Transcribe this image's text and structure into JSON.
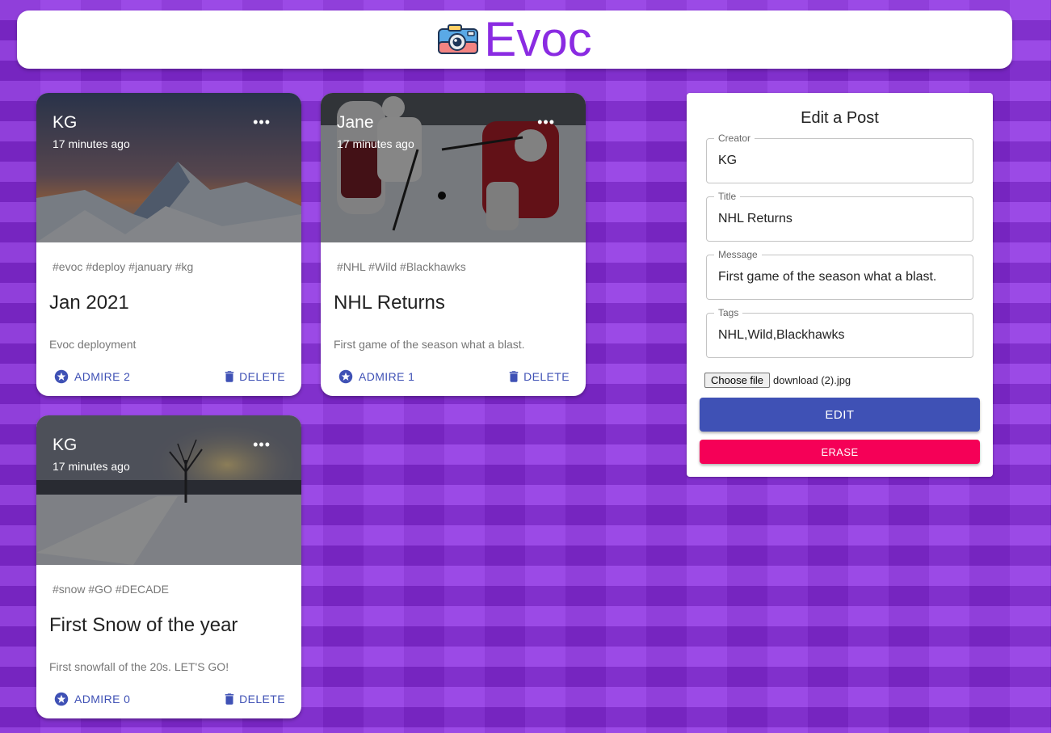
{
  "app": {
    "title": "Evoc",
    "logo_icon": "camera-icon"
  },
  "colors": {
    "accent": "#8a2be2",
    "primary": "#3f51b5",
    "secondary": "#f50057"
  },
  "posts": [
    {
      "creator": "KG",
      "time": "17 minutes ago",
      "more": "•••",
      "tags": "#evoc #deploy #january #kg",
      "title": "Jan 2021",
      "message": "Evoc deployment",
      "admire_label": "ADMIRE 2",
      "delete_label": "DELETE",
      "image": "mountain-sunset"
    },
    {
      "creator": "Jane",
      "time": "17 minutes ago",
      "more": "•••",
      "tags": "#NHL #Wild #Blackhawks",
      "title": "NHL Returns",
      "message": "First game of the season what a blast.",
      "admire_label": "ADMIRE 1",
      "delete_label": "DELETE",
      "image": "hockey-game"
    },
    {
      "creator": "KG",
      "time": "17 minutes ago",
      "more": "•••",
      "tags": "#snow #GO #DECADE",
      "title": "First Snow of the year",
      "message": "First snowfall of the 20s. LET'S GO!",
      "admire_label": "ADMIRE 0",
      "delete_label": "DELETE",
      "image": "snowy-field"
    }
  ],
  "form": {
    "heading": "Edit a Post",
    "creator_label": "Creator",
    "creator_value": "KG",
    "title_label": "Title",
    "title_value": "NHL Returns",
    "message_label": "Message",
    "message_value": "First game of the season what a blast.",
    "tags_label": "Tags",
    "tags_value": "NHL,Wild,Blackhawks",
    "choose_file_label": "Choose file",
    "file_name": "download (2).jpg",
    "submit_label": "EDIT",
    "clear_label": "ERASE"
  }
}
